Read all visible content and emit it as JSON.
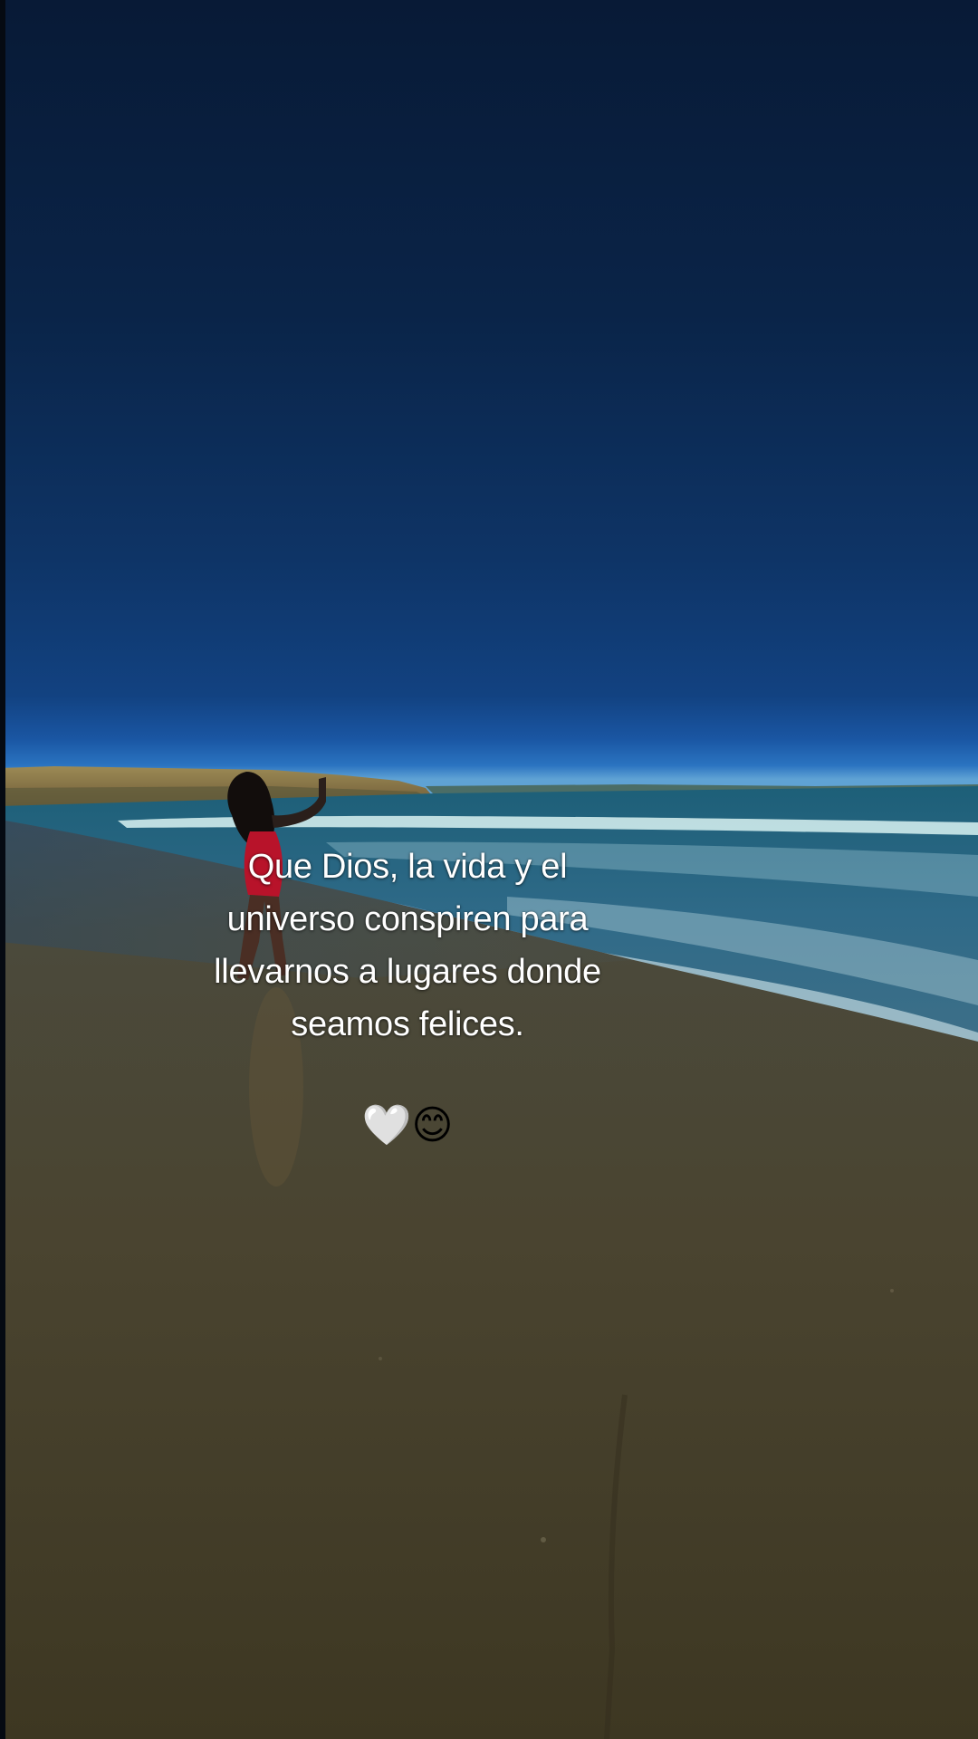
{
  "caption": {
    "lines": [
      "Que Dios, la vida y el",
      "universo conspiren para",
      "llevarnos a lugares donde",
      "seamos felices."
    ],
    "emoji_1": "🤍",
    "emoji_2": "😊"
  },
  "colors": {
    "sky_top": "#081a36",
    "sky_horizon": "#2a73c0",
    "sea": "#2b5a7a",
    "surf": "#cfeef0",
    "sand": "#4a4330",
    "swimsuit": "#b8132a"
  }
}
